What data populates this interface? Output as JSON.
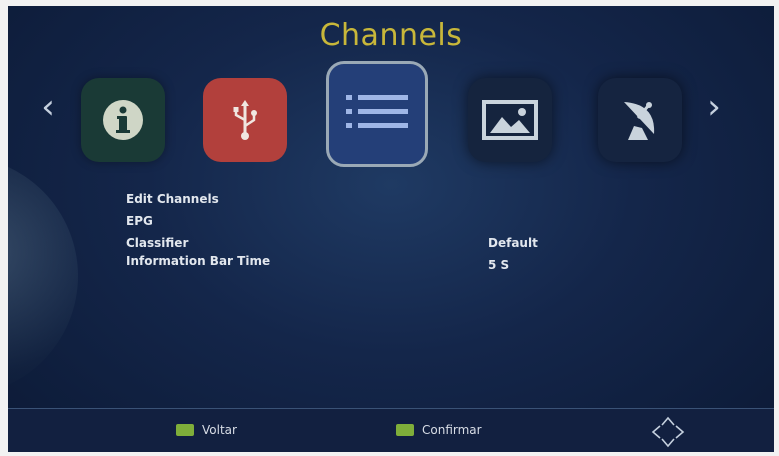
{
  "header": {
    "title": "Channels"
  },
  "carousel": {
    "prev_glyph": "‹",
    "next_glyph": "›",
    "items": [
      {
        "icon": "info-icon",
        "color": "#1a3a36"
      },
      {
        "icon": "usb-icon",
        "color": "#b2403c"
      },
      {
        "icon": "channel-list-icon",
        "color": "#243f78",
        "selected": true
      },
      {
        "icon": "picture-icon",
        "color": "#15243e"
      },
      {
        "icon": "satellite-dish-icon",
        "color": "#152440"
      }
    ]
  },
  "menu": {
    "items": [
      {
        "label": "Edit Channels",
        "value": ""
      },
      {
        "label": "EPG",
        "value": ""
      },
      {
        "label": "Classifier",
        "value": "Default"
      },
      {
        "label": "Information Bar Time",
        "value": "5 S"
      }
    ]
  },
  "footer": {
    "back_label": "Voltar",
    "confirm_label": "Confirmar",
    "key_color": "#7fae3a"
  },
  "colors": {
    "title": "#c8b73a",
    "background": "#14264a"
  }
}
